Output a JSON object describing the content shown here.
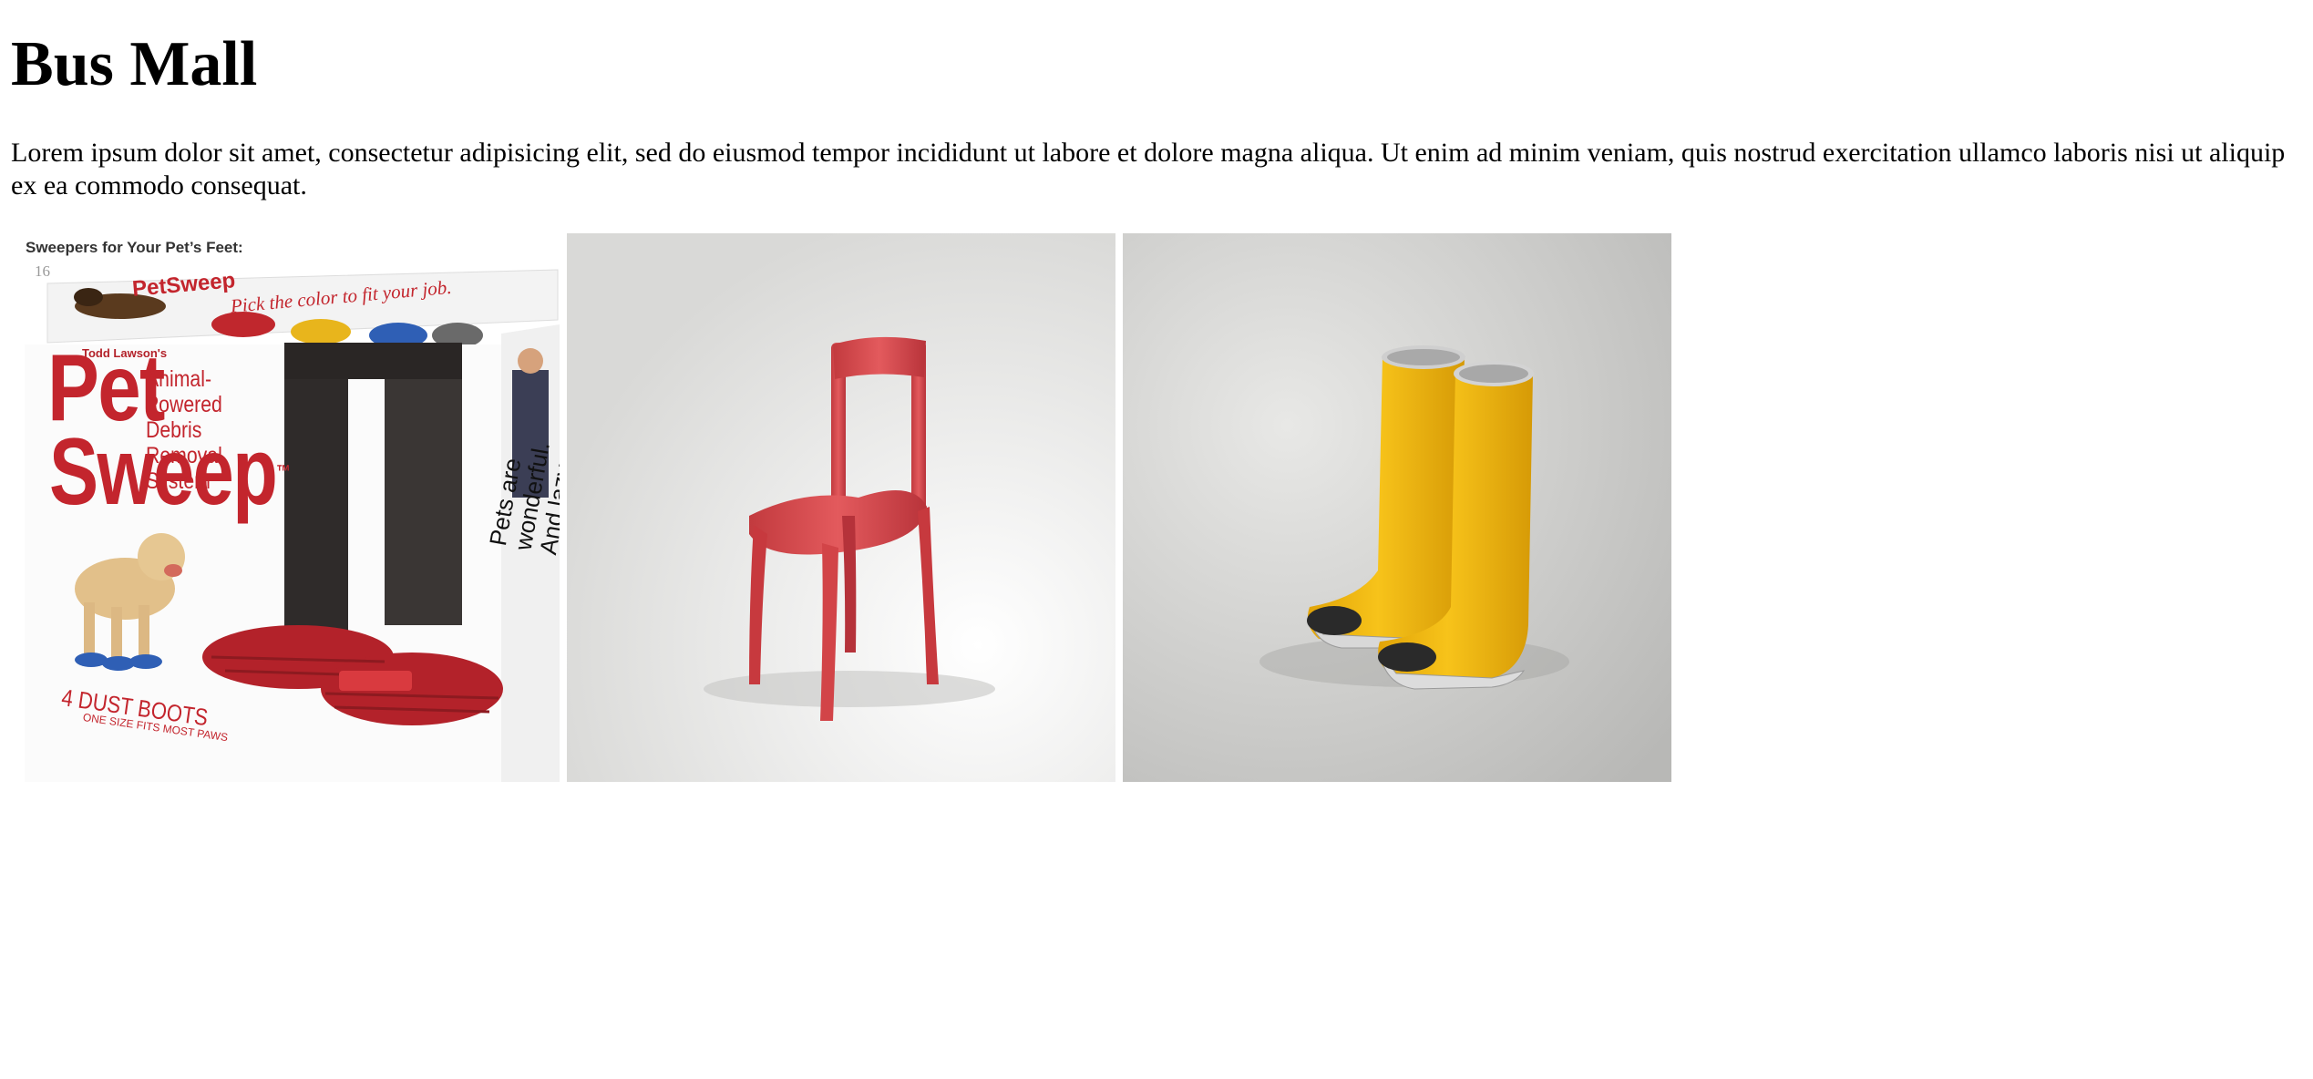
{
  "page": {
    "title": "Bus Mall",
    "intro": "Lorem ipsum dolor sit amet, consectetur adipisicing elit, sed do eiusmod tempor incididunt ut labore et dolore magna aliqua. Ut enim ad minim veniam, quis nostrud exercitation ullamco laboris nisi ut aliquip ex ea commodo consequat."
  },
  "products": [
    {
      "image_name": "pet-sweep",
      "caption": "Sweepers for Your Pet’s Feet:",
      "number": "16",
      "top_brand": "PetSweep",
      "top_text": "Pick the color to fit your job.",
      "brand_small": "Todd Lawson's",
      "brand_line1": "Pet",
      "brand_line2": "Sweep",
      "tm": "™",
      "tagline": "Animal-Powered Debris Removal System",
      "dust_boots": "4 DUST BOOTS",
      "fits": "ONE SIZE FITS MOST PAWS",
      "side_lines": [
        "Pets are",
        "wonderful.",
        "And lazy."
      ]
    },
    {
      "image_name": "chair"
    },
    {
      "image_name": "boots"
    }
  ],
  "colors": {
    "pet_sweep_red": "#c3252d",
    "chair_red": "#d4464a",
    "boots_yellow": "#f2b90c"
  }
}
